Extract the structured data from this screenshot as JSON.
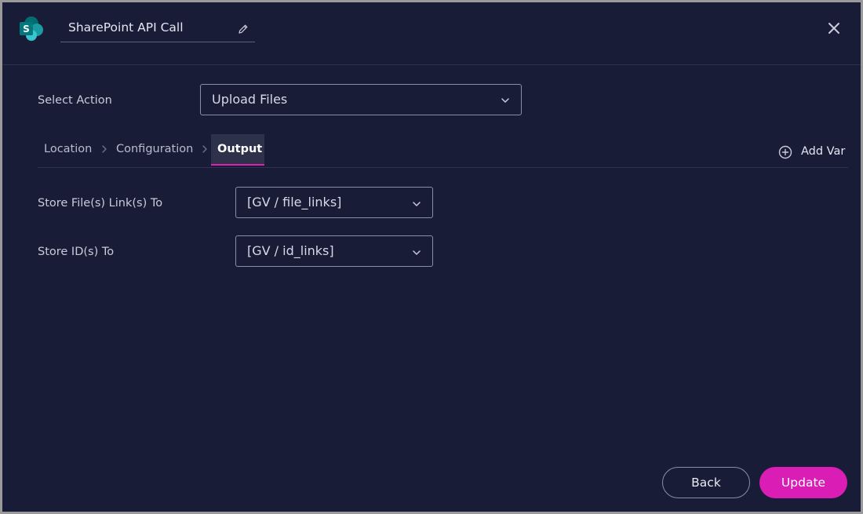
{
  "header": {
    "title": "SharePoint API Call",
    "app_icon": "sharepoint-logo",
    "app_icon_letter": "S",
    "edit_icon": "pencil-icon",
    "close_icon": "close-icon"
  },
  "action": {
    "label": "Select Action",
    "value": "Upload Files"
  },
  "tabs": [
    {
      "label": "Location",
      "active": false
    },
    {
      "label": "Configuration",
      "active": false
    },
    {
      "label": "Output",
      "active": true
    }
  ],
  "add_var": {
    "label": "Add Var",
    "icon": "plus-circle-icon"
  },
  "fields": [
    {
      "label": "Store File(s) Link(s) To",
      "value": "[GV / file_links]"
    },
    {
      "label": "Store ID(s) To",
      "value": "[GV / id_links]"
    }
  ],
  "footer": {
    "back_label": "Back",
    "update_label": "Update"
  },
  "colors": {
    "background": "#181c36",
    "accent": "#d91db5",
    "text": "#e4e6f2"
  }
}
